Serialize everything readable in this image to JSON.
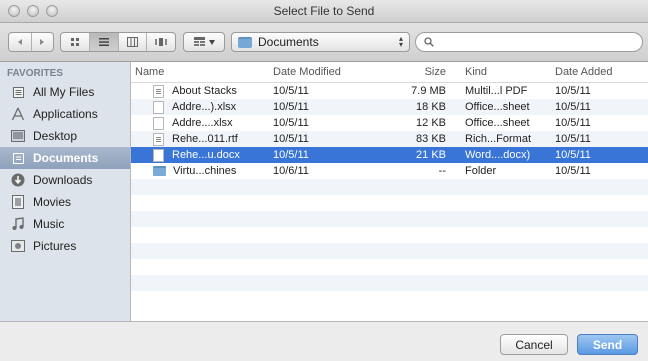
{
  "window": {
    "title": "Select File to Send"
  },
  "toolbar": {
    "back_icon": "back-arrow-icon",
    "forward_icon": "forward-arrow-icon",
    "location_label": "Documents",
    "search_placeholder": "",
    "search_value": ""
  },
  "sidebar": {
    "header": "FAVORITES",
    "items": [
      {
        "label": "All My Files",
        "icon": "all-files-icon"
      },
      {
        "label": "Applications",
        "icon": "applications-icon"
      },
      {
        "label": "Desktop",
        "icon": "desktop-icon"
      },
      {
        "label": "Documents",
        "icon": "documents-icon",
        "selected": true
      },
      {
        "label": "Downloads",
        "icon": "downloads-icon"
      },
      {
        "label": "Movies",
        "icon": "movies-icon"
      },
      {
        "label": "Music",
        "icon": "music-icon"
      },
      {
        "label": "Pictures",
        "icon": "pictures-icon"
      }
    ]
  },
  "list": {
    "columns": {
      "name": "Name",
      "date_modified": "Date Modified",
      "size": "Size",
      "kind": "Kind",
      "date_added": "Date Added"
    },
    "rows": [
      {
        "name": "About Stacks",
        "date_modified": "10/5/11",
        "size": "7.9 MB",
        "kind": "Multil...l PDF",
        "date_added": "10/5/11",
        "type": "file"
      },
      {
        "name": "Addre...).xlsx",
        "date_modified": "10/5/11",
        "size": "18 KB",
        "kind": "Office...sheet",
        "date_added": "10/5/11",
        "type": "file"
      },
      {
        "name": "Addre....xlsx",
        "date_modified": "10/5/11",
        "size": "12 KB",
        "kind": "Office...sheet",
        "date_added": "10/5/11",
        "type": "file"
      },
      {
        "name": "Rehe...011.rtf",
        "date_modified": "10/5/11",
        "size": "83 KB",
        "kind": "Rich...Format",
        "date_added": "10/5/11",
        "type": "file"
      },
      {
        "name": "Rehe...u.docx",
        "date_modified": "10/5/11",
        "size": "21 KB",
        "kind": "Word....docx)",
        "date_added": "10/5/11",
        "type": "file",
        "selected": true
      },
      {
        "name": "Virtu...chines",
        "date_modified": "10/6/11",
        "size": "--",
        "kind": "Folder",
        "date_added": "10/5/11",
        "type": "folder"
      }
    ]
  },
  "buttons": {
    "cancel": "Cancel",
    "send": "Send"
  },
  "colors": {
    "selection": "#3875d7",
    "default_button": "#5a9ae4",
    "sidebar_bg": "#dde3ea"
  }
}
